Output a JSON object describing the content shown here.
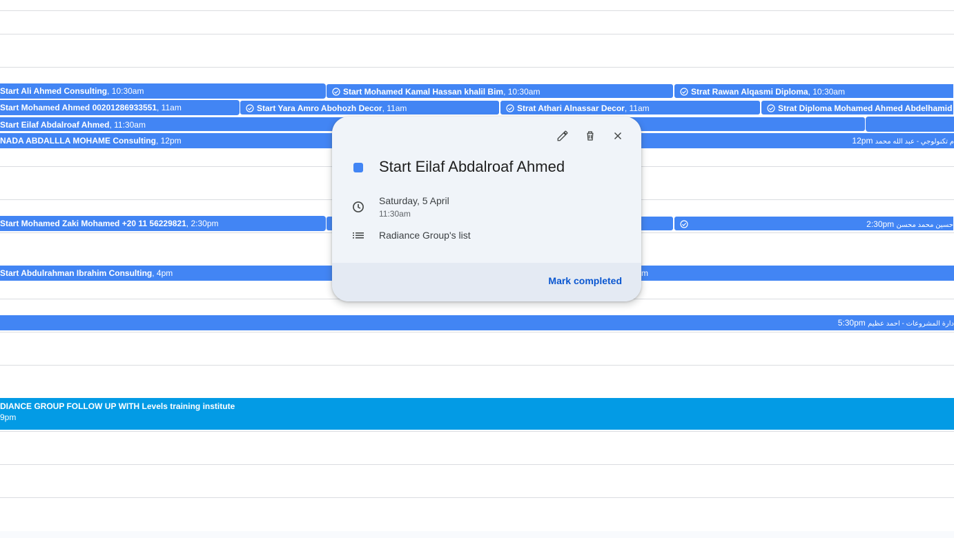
{
  "events": {
    "row1": [
      {
        "title": "Start Ali Ahmed Consulting",
        "time": ", 10:30am"
      },
      {
        "title": "Start Mohamed Kamal Hassan khalil Bim",
        "time": ", 10:30am"
      },
      {
        "title": "Strat Rawan Alqasmi Diploma",
        "time": ", 10:30am"
      }
    ],
    "row2": [
      {
        "title": "Start Mohamed Ahmed 00201286933551",
        "time": ", 11am"
      },
      {
        "title": "Start Yara Amro Abohozh Decor",
        "time": ", 11am"
      },
      {
        "title": "Strat Athari Alnassar Decor",
        "time": ", 11am"
      },
      {
        "title": "Strat Diploma Mohamed Ahmed Abdelhamid",
        "time": ""
      }
    ],
    "row3": [
      {
        "title": "Start Eilaf Abdalroaf Ahmed",
        "time": ", 11:30am"
      }
    ],
    "row4": [
      {
        "title": "NADA ABDALLLA MOHAME Consulting",
        "time": ", 12pm"
      },
      {
        "title": "م تكنولوجي - عبد الله محمد",
        "time": "12pm "
      }
    ],
    "row5": [
      {
        "title": "Start Mohamed Zaki Mohamed +20 11 56229821",
        "time": ", 2:30pm"
      },
      {
        "title": "حسين محمد محسن",
        "time": "2:30pm "
      }
    ],
    "row6": [
      {
        "title": "Start Abdulrahman Ibrahim Consulting",
        "time": ", 4pm"
      },
      {
        "title": "",
        "time": "m"
      }
    ],
    "row7": [
      {
        "title": "دارة المشروعات - احمد عظيم",
        "time": "5:30pm "
      }
    ],
    "row8": {
      "title": "DIANCE GROUP FOLLOW UP WITH Levels training institute",
      "time": "9pm"
    }
  },
  "popup": {
    "title": "Start Eilaf Abdalroaf Ahmed",
    "date": "Saturday, 5 April",
    "time": "11:30am",
    "list": "Radiance Group's list",
    "mark_completed": "Mark completed",
    "icons": {
      "edit": "pencil-icon",
      "delete": "trash-icon",
      "close": "close-icon",
      "clock": "clock-icon",
      "list": "list-icon"
    },
    "color": "#4285f4"
  },
  "colors": {
    "event_blue": "#4285f4",
    "event_cyan": "#039be5",
    "gridline": "#dadce0",
    "popup_bg": "#f0f4f9",
    "link_blue": "#0b57d0"
  }
}
